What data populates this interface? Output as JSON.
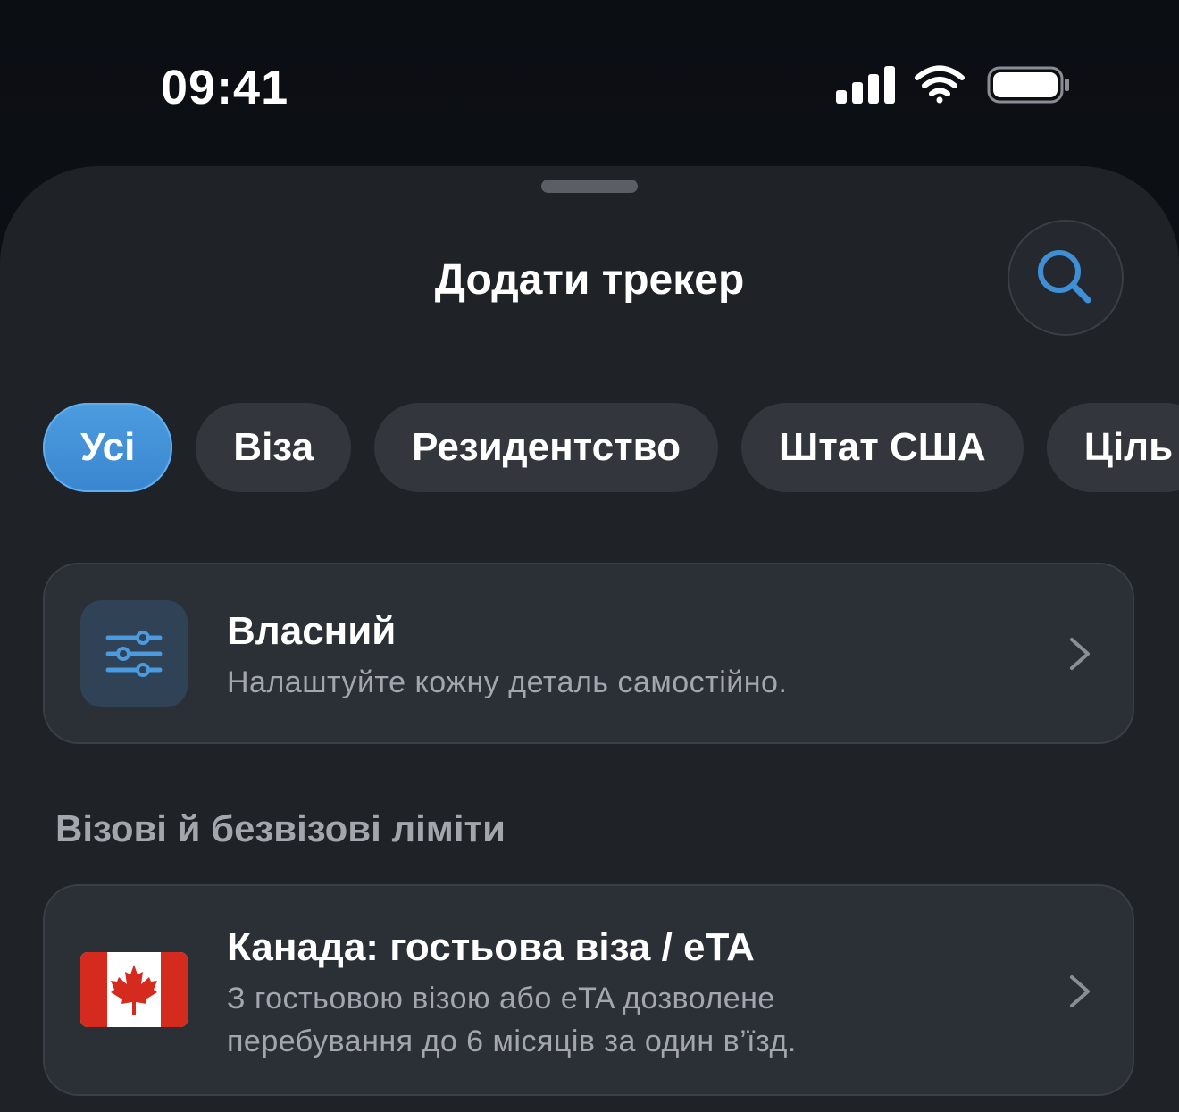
{
  "status_bar": {
    "time": "09:41",
    "icons": [
      "cellular-signal-icon",
      "wifi-icon",
      "battery-icon"
    ]
  },
  "sheet": {
    "title": "Додати трекер",
    "search_icon": "search-icon"
  },
  "filters": {
    "chips": [
      {
        "label": "Усі",
        "active": true
      },
      {
        "label": "Віза",
        "active": false
      },
      {
        "label": "Резидентство",
        "active": false
      },
      {
        "label": "Штат США",
        "active": false
      },
      {
        "label": "Ціль",
        "active": false
      }
    ]
  },
  "custom_card": {
    "icon": "sliders-icon",
    "title": "Власний",
    "subtitle": "Налаштуйте кожну деталь самостійно."
  },
  "section": {
    "title": "Візові й безвізові ліміти"
  },
  "items": [
    {
      "icon": "canada-flag-icon",
      "title": "Канада: гостьова віза / eTA",
      "subtitle_line1": "З гостьовою візою або eTA дозволене",
      "subtitle_line2": "перебування до 6 місяців за один в’їзд."
    }
  ],
  "colors": {
    "accent": "#3a86cf",
    "sheet_background": "#1f2227",
    "card_background": "#2b2f36",
    "secondary_text": "#a3a6ad",
    "canada_red": "#d52b1e"
  }
}
